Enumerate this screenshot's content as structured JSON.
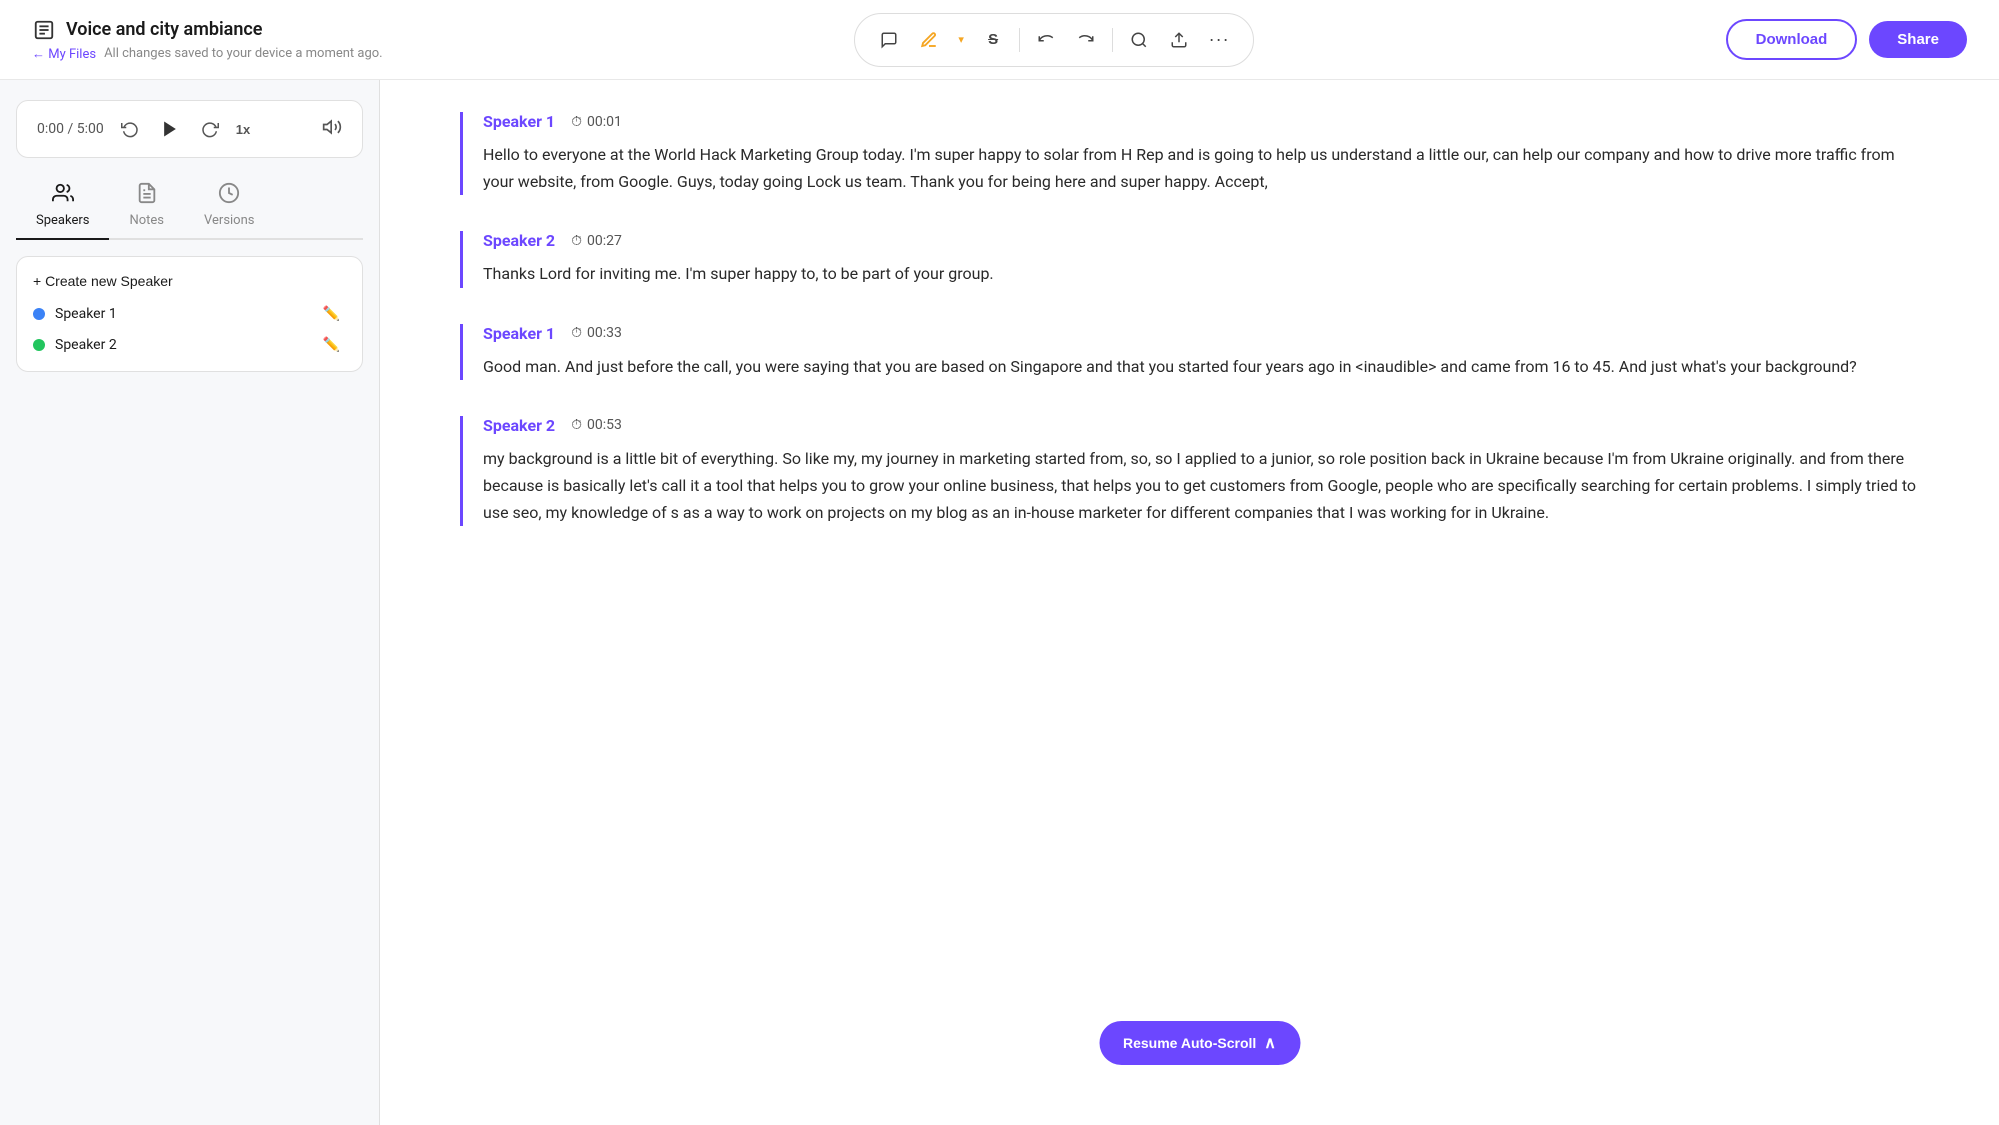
{
  "header": {
    "file_icon": "📄",
    "title": "Voice and city ambiance",
    "back_label": "← My Files",
    "autosave": "All changes saved to your device a moment ago.",
    "download_label": "Download",
    "share_label": "Share"
  },
  "toolbar": {
    "comment_icon": "💬",
    "pen_icon": "✏️",
    "strikethrough_icon": "S",
    "undo_icon": "↩",
    "redo_icon": "↪",
    "search_icon": "🔍",
    "upload_icon": "⬆",
    "more_icon": "···"
  },
  "player": {
    "current_time": "0:00",
    "total_time": "5:00",
    "display": "0:00 / 5:00",
    "speed": "1x",
    "rewind_icon": "↺",
    "play_icon": "▶",
    "forward_icon": "↻",
    "volume_icon": "🔊"
  },
  "tabs": [
    {
      "id": "speakers",
      "label": "Speakers",
      "icon": "👥",
      "active": true
    },
    {
      "id": "notes",
      "label": "Notes",
      "icon": "📄",
      "active": false
    },
    {
      "id": "versions",
      "label": "Versions",
      "icon": "🕐",
      "active": false
    }
  ],
  "speakers": {
    "create_label": "+ Create new Speaker",
    "list": [
      {
        "name": "Speaker 1",
        "color": "#3b82f6"
      },
      {
        "name": "Speaker 2",
        "color": "#22c55e"
      }
    ]
  },
  "transcript": [
    {
      "speaker": "Speaker 1",
      "timestamp": "00:01",
      "text": "Hello to everyone at the World Hack Marketing Group today. I'm super happy to solar from H Rep and is going to help us understand a little our, can help our company and how to drive more traffic from your website, from Google. Guys, today going Lock us team. Thank you for being here and super happy. Accept,"
    },
    {
      "speaker": "Speaker 2",
      "timestamp": "00:27",
      "text": "Thanks Lord for inviting me. I'm super happy to, to be part of your group."
    },
    {
      "speaker": "Speaker 1",
      "timestamp": "00:33",
      "text": "Good man. And just before the call, you were saying that you are based on Singapore and that you started four years ago in <inaudible> and came from 16 to 45. And just what's your background?"
    },
    {
      "speaker": "Speaker 2",
      "timestamp": "00:53",
      "text": " my background is a little bit of everything. So like my, my journey in marketing started from, so, so I applied to a junior, so role position back in Ukraine because I'm from Ukraine originally. and from there because is basically let's call it a tool that helps you to grow your online business, that helps you to get customers from Google, people who are specifically searching for certain problems. I simply tried to use seo, my knowledge of s as a way to work on projects on my blog as an in-house marketer for different companies that I was working for in Ukraine."
    }
  ],
  "auto_scroll_label": "Resume Auto-Scroll",
  "colors": {
    "accent": "#6c47ff",
    "speaker1": "#6c47ff",
    "speaker2": "#6c47ff",
    "dot1": "#3b82f6",
    "dot2": "#22c55e"
  }
}
